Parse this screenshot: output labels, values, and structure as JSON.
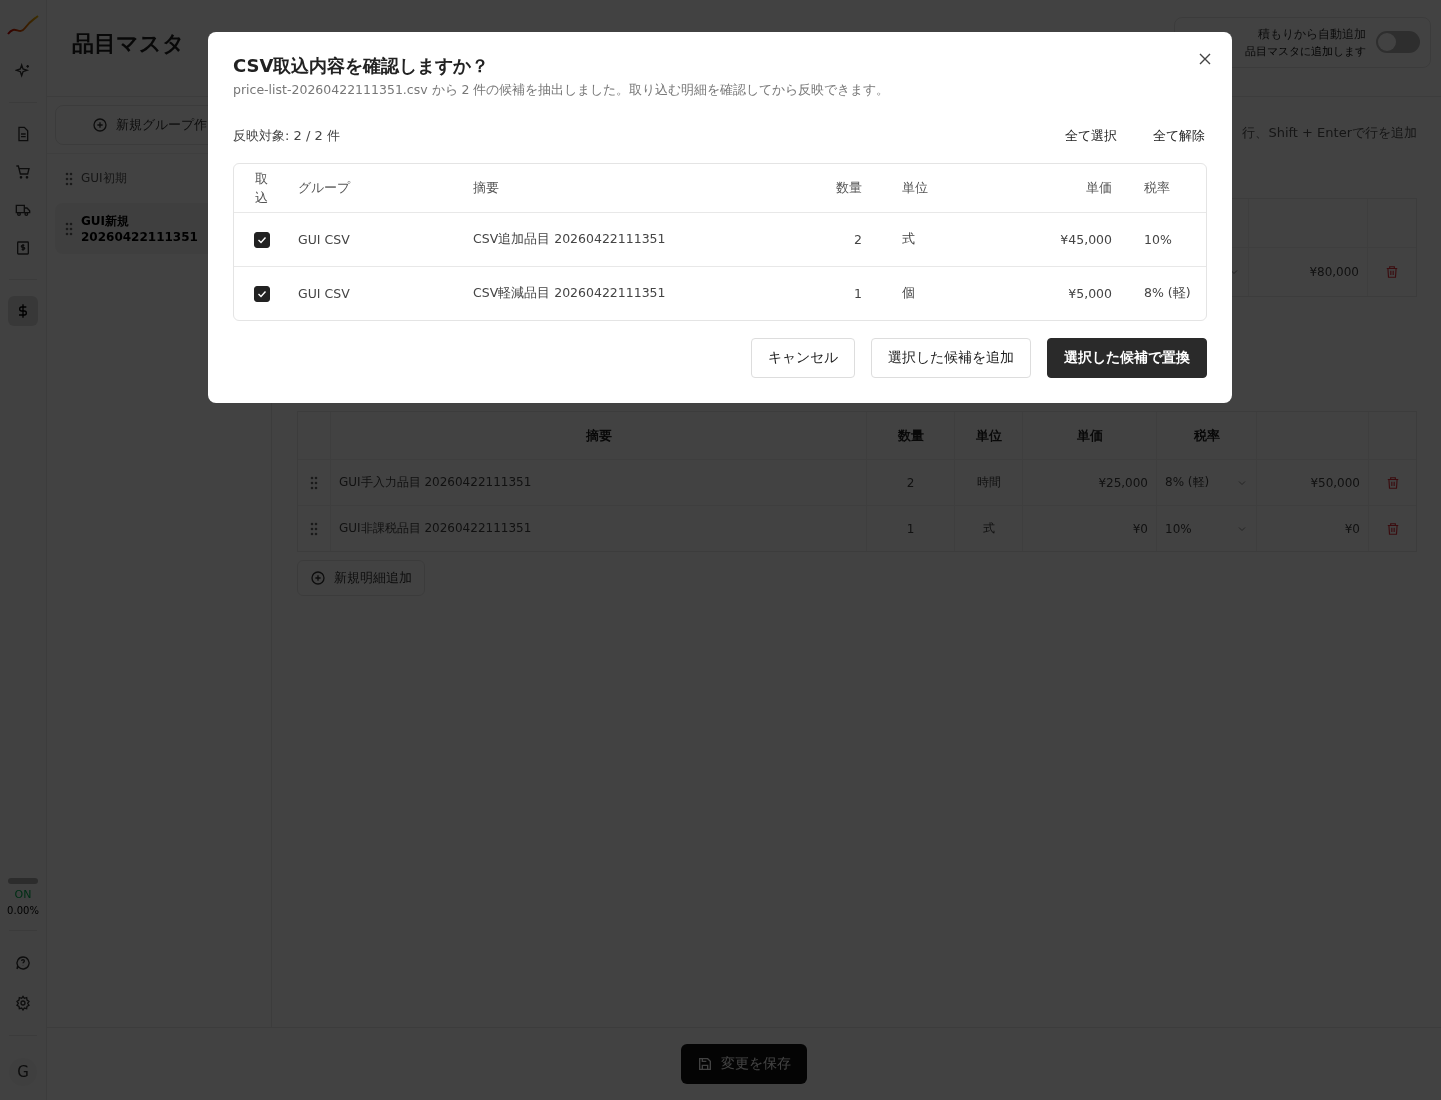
{
  "sidebar": {
    "nav": [
      {
        "kind": "sparkle",
        "selected": false
      },
      {
        "kind": "document",
        "selected": false
      },
      {
        "kind": "cart",
        "selected": false
      },
      {
        "kind": "truck",
        "selected": false
      },
      {
        "kind": "receipt",
        "selected": false
      },
      {
        "kind": "dollar",
        "selected": true
      }
    ],
    "usage": {
      "status": "ON",
      "reading": "0.00%",
      "level": 0
    },
    "avatar": "G"
  },
  "page": {
    "title": "品目マスタ",
    "auto_add": {
      "label": "積もりから自動追加",
      "description": "品目マスタに追加します",
      "on": false
    },
    "hint": "行、Shift + Enterで行を追加"
  },
  "groups": {
    "new_button": "新規グループ作",
    "items": [
      {
        "name": "GUI初期",
        "selected": false
      },
      {
        "name": "GUI新規 20260422111351",
        "selected": true
      }
    ]
  },
  "upper_table": {
    "rows": [
      {
        "amount": "¥80,000"
      }
    ]
  },
  "lower_table": {
    "columns": [
      "摘要",
      "数量",
      "単位",
      "単価",
      "税率"
    ],
    "rows": [
      {
        "description": "GUI手入力品目 20260422111351",
        "qty": "2",
        "unit": "時間",
        "price": "¥25,000",
        "tax": "8% (軽)",
        "amount": "¥50,000"
      },
      {
        "description": "GUI非課税品目 20260422111351",
        "qty": "1",
        "unit": "式",
        "price": "¥0",
        "tax": "10%",
        "amount": "¥0"
      }
    ],
    "add_button": "新規明細追加"
  },
  "save_button": "変更を保存",
  "dialog": {
    "title": "CSV取込内容を確認しますか？",
    "subtitle": "price-list-20260422111351.csv から 2 件の候補を抽出しました。取り込む明細を確認してから反映できます。",
    "count": "反映対象: 2 / 2 件",
    "select_all": "全て選択",
    "deselect_all": "全て解除",
    "columns": [
      "取込",
      "グループ",
      "摘要",
      "数量",
      "単位",
      "単価",
      "税率"
    ],
    "rows": [
      {
        "checked": true,
        "group": "GUI CSV",
        "description": "CSV追加品目 20260422111351",
        "qty": "2",
        "unit": "式",
        "price": "¥45,000",
        "tax": "10%"
      },
      {
        "checked": true,
        "group": "GUI CSV",
        "description": "CSV軽減品目 20260422111351",
        "qty": "1",
        "unit": "個",
        "price": "¥5,000",
        "tax": "8% (軽)"
      }
    ],
    "buttons": [
      {
        "label": "キャンセル",
        "kind": "secondary"
      },
      {
        "label": "選択した候補を追加",
        "kind": "secondary"
      },
      {
        "label": "選択した候補で置換",
        "kind": "primary"
      }
    ]
  }
}
